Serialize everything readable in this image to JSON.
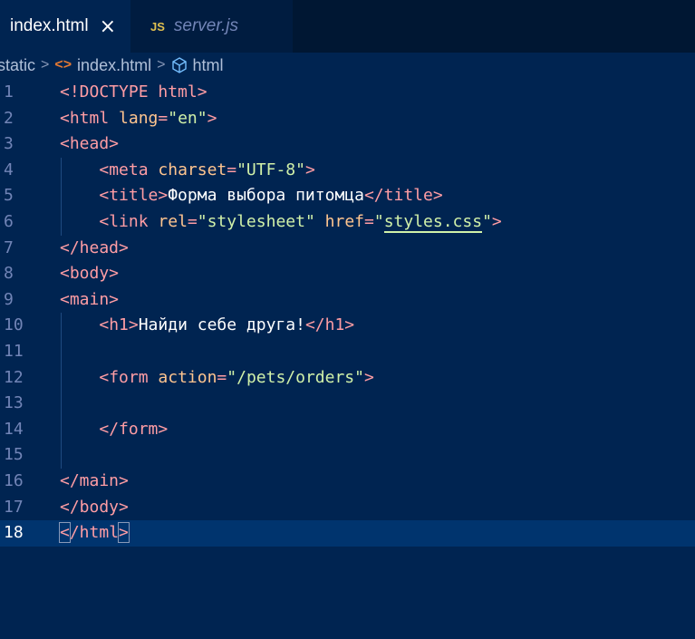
{
  "tabs": [
    {
      "label": "index.html",
      "active": true,
      "close_icon": "×"
    },
    {
      "label": "server.js",
      "active": false,
      "badge": "JS"
    }
  ],
  "breadcrumb": {
    "items": [
      "static",
      "index.html",
      "html"
    ],
    "separator": ">",
    "html_icon": "<>"
  },
  "colors": {
    "background": "#002451",
    "tag": "#ff9da4",
    "attribute": "#ffc58f",
    "string": "#d1f1a9",
    "line_number": "#7285b7",
    "current_line": "#00346e"
  },
  "editor": {
    "current_line": 18,
    "lines": [
      {
        "n": "1",
        "tokens": [
          [
            "t",
            "<!DOCTYPE html>"
          ]
        ]
      },
      {
        "n": "2",
        "tokens": [
          [
            "t",
            "<html "
          ],
          [
            "a",
            "lang"
          ],
          [
            "t",
            "="
          ],
          [
            "s",
            "\"en\""
          ],
          [
            "t",
            ">"
          ]
        ]
      },
      {
        "n": "3",
        "tokens": [
          [
            "t",
            "<head>"
          ]
        ]
      },
      {
        "n": "4",
        "tokens": [
          [
            "p",
            "    "
          ],
          [
            "t",
            "<meta "
          ],
          [
            "a",
            "charset"
          ],
          [
            "t",
            "="
          ],
          [
            "s",
            "\"UTF-8\""
          ],
          [
            "t",
            ">"
          ]
        ]
      },
      {
        "n": "5",
        "tokens": [
          [
            "p",
            "    "
          ],
          [
            "t",
            "<title>"
          ],
          [
            "w",
            "Форма выбора питомца"
          ],
          [
            "t",
            "</title>"
          ]
        ]
      },
      {
        "n": "6",
        "tokens": [
          [
            "p",
            "    "
          ],
          [
            "t",
            "<link "
          ],
          [
            "a",
            "rel"
          ],
          [
            "t",
            "="
          ],
          [
            "s",
            "\"stylesheet\""
          ],
          [
            "p",
            " "
          ],
          [
            "a",
            "href"
          ],
          [
            "t",
            "="
          ],
          [
            "s",
            "\""
          ],
          [
            "u",
            "styles.css"
          ],
          [
            "s",
            "\""
          ],
          [
            "t",
            ">"
          ]
        ]
      },
      {
        "n": "7",
        "tokens": [
          [
            "t",
            "</head>"
          ]
        ]
      },
      {
        "n": "8",
        "tokens": [
          [
            "t",
            "<body>"
          ]
        ]
      },
      {
        "n": "9",
        "tokens": [
          [
            "t",
            "<main>"
          ]
        ]
      },
      {
        "n": "10",
        "tokens": [
          [
            "p",
            "    "
          ],
          [
            "t",
            "<h1>"
          ],
          [
            "w",
            "Найди себе друга!"
          ],
          [
            "t",
            "</h1>"
          ]
        ]
      },
      {
        "n": "11",
        "tokens": []
      },
      {
        "n": "12",
        "tokens": [
          [
            "p",
            "    "
          ],
          [
            "t",
            "<form "
          ],
          [
            "a",
            "action"
          ],
          [
            "t",
            "="
          ],
          [
            "s",
            "\"/pets/orders\""
          ],
          [
            "t",
            ">"
          ]
        ]
      },
      {
        "n": "13",
        "tokens": []
      },
      {
        "n": "14",
        "tokens": [
          [
            "p",
            "    "
          ],
          [
            "t",
            "</form>"
          ]
        ]
      },
      {
        "n": "15",
        "tokens": []
      },
      {
        "n": "16",
        "tokens": [
          [
            "t",
            "</main>"
          ]
        ]
      },
      {
        "n": "17",
        "tokens": [
          [
            "t",
            "</body>"
          ]
        ]
      },
      {
        "n": "18",
        "tokens": [
          [
            "b",
            "<"
          ],
          [
            "t",
            "/html"
          ],
          [
            "b",
            ">"
          ]
        ]
      }
    ]
  }
}
